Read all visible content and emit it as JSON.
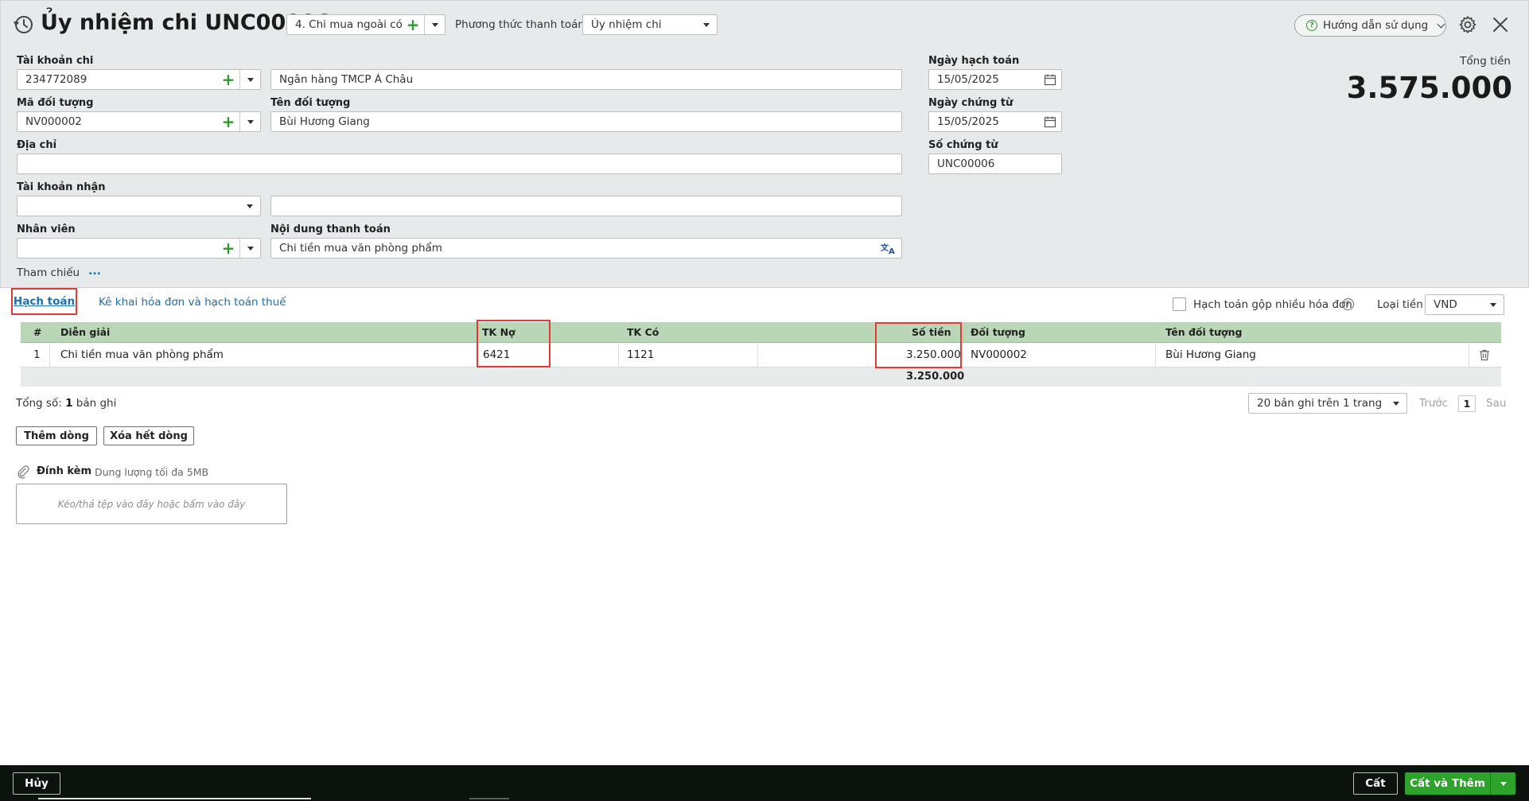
{
  "header": {
    "title": "Ủy nhiệm chi UNC00006",
    "voucher_type": "4. Chi mua ngoài có ...",
    "payment_method_label": "Phương thức thanh toán",
    "payment_method_value": "Ủy nhiệm chi",
    "help_label": "Hướng dẫn sử dụng"
  },
  "form": {
    "account_label": "Tài khoản chi",
    "account_value": "234772089",
    "bank_name": "Ngân hàng TMCP Á Châu",
    "object_code_label": "Mã đối tượng",
    "object_code_value": "NV000002",
    "object_name_label": "Tên đối tượng",
    "object_name_value": "Bùi Hương Giang",
    "address_label": "Địa chỉ",
    "address_value": "",
    "receive_account_label": "Tài khoản nhận",
    "receive_account_value": "",
    "receive_bank_value": "",
    "employee_label": "Nhân viên",
    "employee_value": "",
    "content_label": "Nội dung thanh toán",
    "content_value": "Chi tiền mua văn phòng phẩm",
    "reference_label": "Tham chiếu",
    "reference_more": "...",
    "posting_date_label": "Ngày hạch toán",
    "posting_date_value": "15/05/2025",
    "voucher_date_label": "Ngày chứng từ",
    "voucher_date_value": "15/05/2025",
    "voucher_no_label": "Số chứng từ",
    "voucher_no_value": "UNC00006",
    "total_label": "Tổng tiền",
    "total_value": "3.575.000"
  },
  "tabs": {
    "accounting": "Hạch toán",
    "invoice_tax": "Kê khai hóa đơn và hạch toán thuế",
    "merge_label": "Hạch toán gộp nhiều hóa đơn",
    "currency_label": "Loại tiền",
    "currency_value": "VND"
  },
  "grid": {
    "headers": {
      "no": "#",
      "desc": "Diễn giải",
      "debit": "TK Nợ",
      "credit": "TK Có",
      "amount": "Số tiền",
      "object": "Đối tượng",
      "object_name": "Tên đối tượng"
    },
    "rows": [
      {
        "no": "1",
        "desc": "Chi tiền mua văn phòng phẩm",
        "debit": "6421",
        "credit": "1121",
        "amount": "3.250.000",
        "object": "NV000002",
        "object_name": "Bùi Hương Giang"
      }
    ],
    "sum_amount": "3.250.000",
    "count_prefix": "Tổng số:",
    "count_value": "1",
    "count_suffix": "bản ghi",
    "page_size": "20 bản ghi trên 1 trang",
    "prev": "Trước",
    "page": "1",
    "next": "Sau",
    "add_row": "Thêm dòng",
    "delete_rows": "Xóa hết dòng"
  },
  "attachment": {
    "label": "Đính kèm",
    "hint": "Dung lượng tối đa 5MB",
    "drop_text": "Kéo/thả tệp vào đây hoặc bấm vào đây"
  },
  "footer": {
    "cancel": "Hủy",
    "save": "Cất",
    "save_add": "Cất và Thêm"
  },
  "colors": {
    "accent_green": "#2da32b",
    "link_blue": "#1b6fb3",
    "highlight_red": "#e53935",
    "grid_header": "#b9d6b6",
    "footer_bg": "#0c130e"
  }
}
